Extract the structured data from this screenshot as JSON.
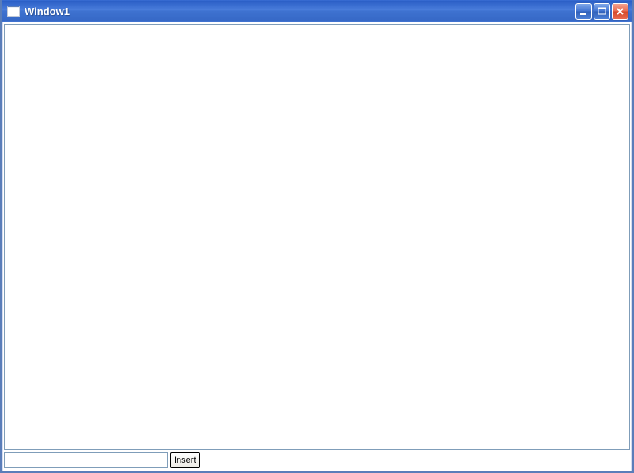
{
  "window": {
    "title": "Window1"
  },
  "controls": {
    "minimize": "minimize",
    "maximize": "maximize",
    "close": "close"
  },
  "form": {
    "input_value": "",
    "insert_label": "Insert"
  }
}
